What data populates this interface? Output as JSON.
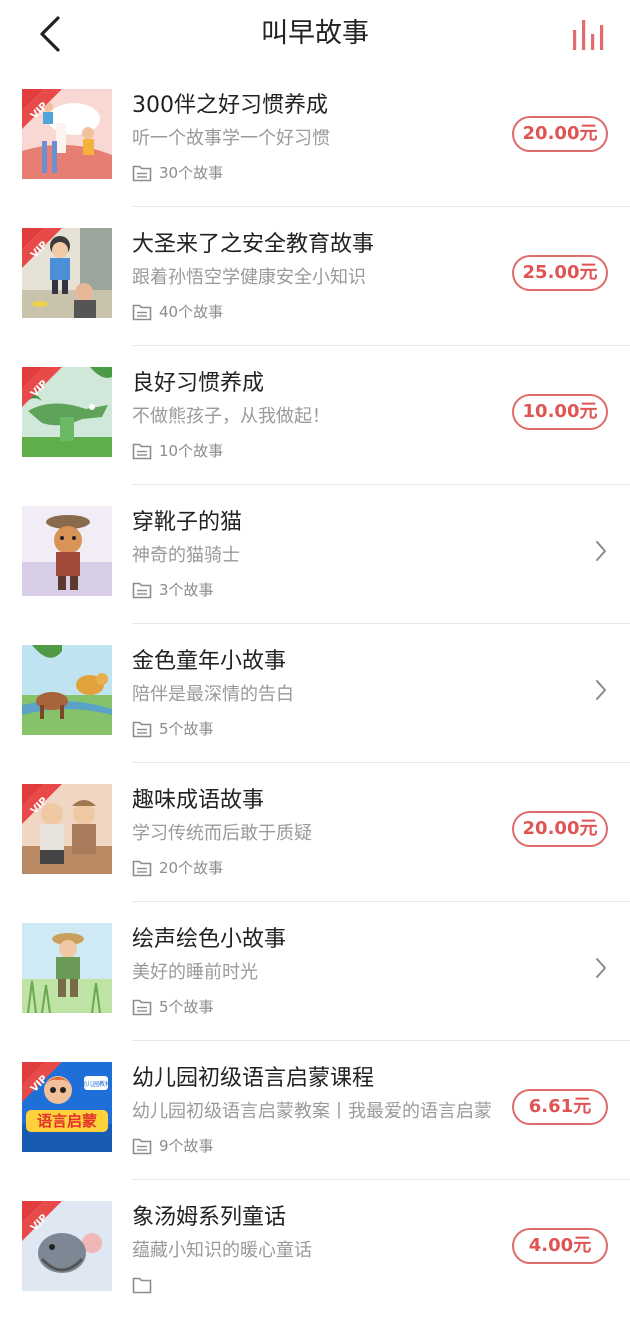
{
  "header": {
    "title": "叫早故事",
    "back_icon": "back-arrow-icon",
    "chart_icon": "bar-chart-icon",
    "accent": "#e05454"
  },
  "items": [
    {
      "title": "300伴之好习惯养成",
      "subtitle": "听一个故事学一个好习惯",
      "count": "30个故事",
      "price": "20.00元",
      "vip": true
    },
    {
      "title": "大圣来了之安全教育故事",
      "subtitle": "跟着孙悟空学健康安全小知识",
      "count": "40个故事",
      "price": "25.00元",
      "vip": true
    },
    {
      "title": "良好习惯养成",
      "subtitle": "不做熊孩子，从我做起！",
      "count": "10个故事",
      "price": "10.00元",
      "vip": true
    },
    {
      "title": "穿靴子的猫",
      "subtitle": "神奇的猫骑士",
      "count": "3个故事",
      "price": null,
      "vip": false
    },
    {
      "title": "金色童年小故事",
      "subtitle": "陪伴是最深情的告白",
      "count": "5个故事",
      "price": null,
      "vip": false
    },
    {
      "title": "趣味成语故事",
      "subtitle": "学习传统而后敢于质疑",
      "count": "20个故事",
      "price": "20.00元",
      "vip": true
    },
    {
      "title": "绘声绘色小故事",
      "subtitle": "美好的睡前时光",
      "count": "5个故事",
      "price": null,
      "vip": false
    },
    {
      "title": "幼儿园初级语言启蒙课程",
      "subtitle": "幼儿园初级语言启蒙教案丨我最爱的语言启蒙",
      "count": "9个故事",
      "price": "6.61元",
      "vip": true,
      "cover_text": "语言启蒙",
      "cover_badge": "幼儿园教材"
    },
    {
      "title": "象汤姆系列童话",
      "subtitle": "蕴藏小知识的暖心童话",
      "count": "",
      "price": "4.00元",
      "vip": true
    }
  ],
  "vip_label": "VIP",
  "colors": {
    "price": "#e05454",
    "title": "#222222",
    "subtitle": "#9a9a9a",
    "divider": "#e6e6e6"
  }
}
